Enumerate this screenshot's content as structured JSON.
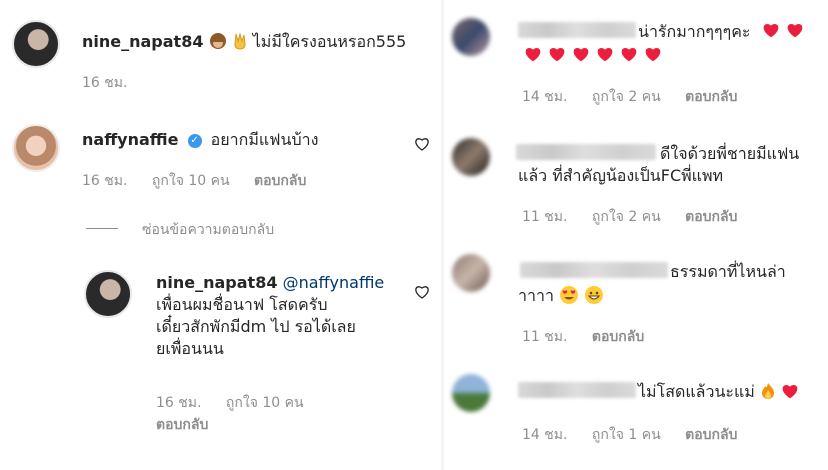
{
  "left": {
    "comment1": {
      "username": "nine_napat84",
      "text": "ไม่มีใครงอนหรอก555",
      "time": "16 ชม."
    },
    "comment2": {
      "username": "naffynaffie",
      "text": "อยากมีแฟนบ้าง",
      "time": "16 ชม.",
      "likes": "ถูกใจ 10 คน",
      "reply": "ตอบกลับ"
    },
    "hide_replies": "ซ่อนข้อความตอบกลับ",
    "reply1": {
      "username": "nine_napat84",
      "mention": "@naffynaffie",
      "line1": "เพื่อนผมชื่อนาฟ โสดครับ",
      "line2": "เดี๋ยวสักพักมีdm ไป รอได้เลย",
      "line3": "ยเพื่อนนน",
      "time": "16 ชม.",
      "likes": "ถูกใจ 10 คน",
      "reply": "ตอบกลับ"
    }
  },
  "right": {
    "c1": {
      "text": "น่ารักมากๆๆๆคะ",
      "time": "14 ชม.",
      "likes": "ถูกใจ 2 คน",
      "reply": "ตอบกลับ"
    },
    "c2": {
      "line1": "ดีใจด้วยพี่ชายมีแฟน",
      "line2": "แล้ว ที่สำคัญน้องเป็นFCพี่แพท",
      "time": "11 ชม.",
      "likes": "ถูกใจ 2 คน",
      "reply": "ตอบกลับ"
    },
    "c3": {
      "line1": "ธรรมดาที่ไหนล่า",
      "line2": "าาาา",
      "time": "11 ชม.",
      "reply": "ตอบกลับ"
    },
    "c4": {
      "text": "ไม่โสดแล้วนะแม่",
      "time": "14 ชม.",
      "likes": "ถูกใจ 1 คน",
      "reply": "ตอบกลับ"
    }
  },
  "colors": {
    "heart": "#ed1d3d",
    "link": "#00376b",
    "meta": "#8e8e8e",
    "verified": "#3897f0"
  }
}
